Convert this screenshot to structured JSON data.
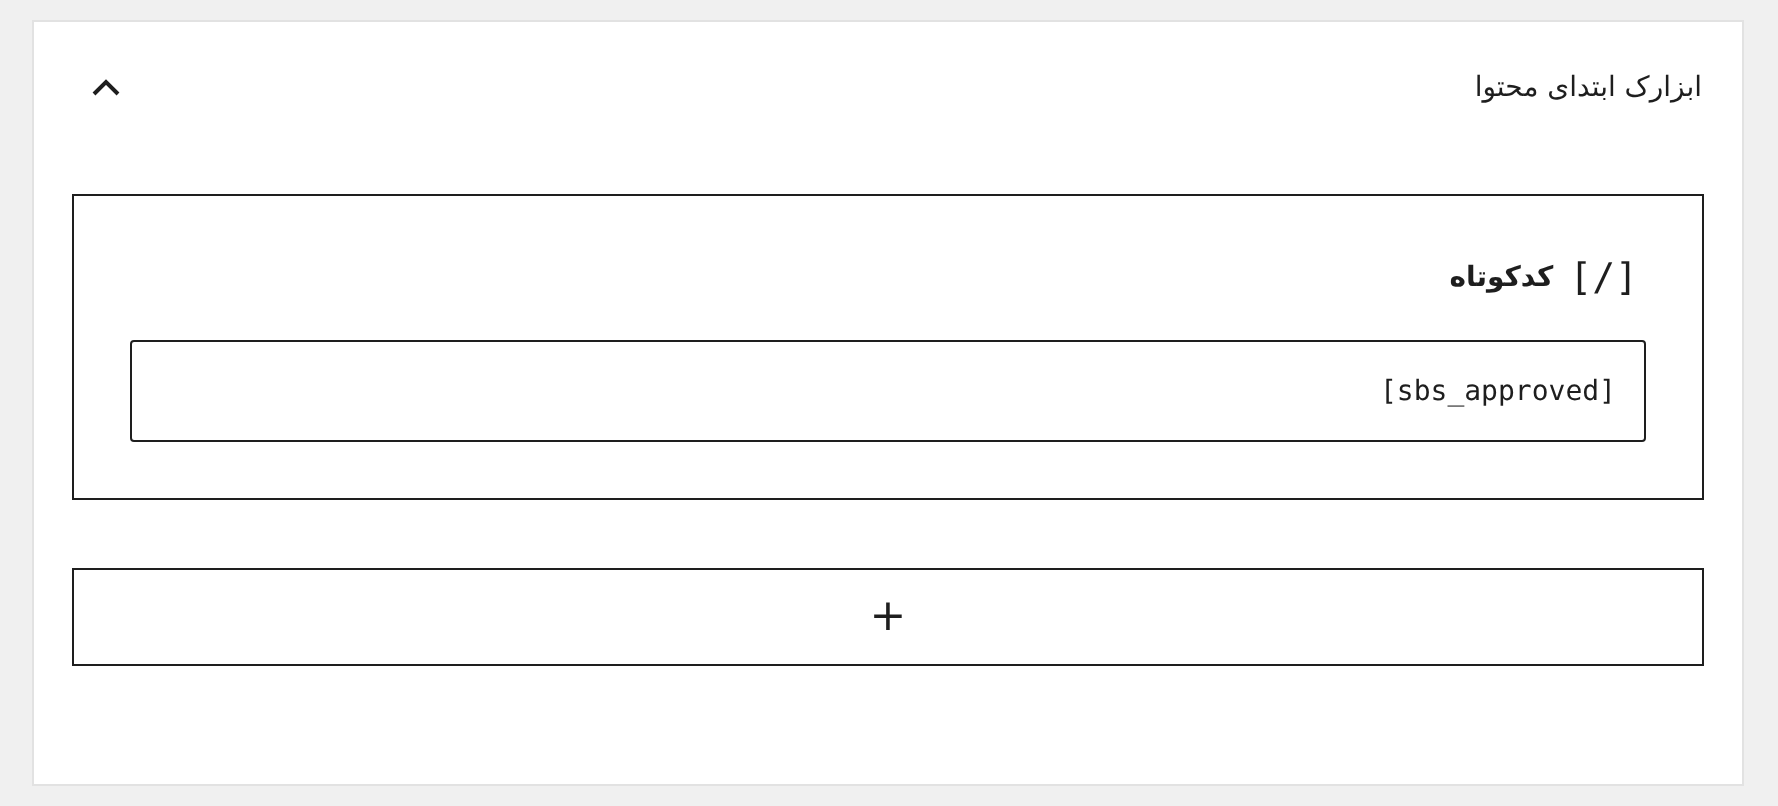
{
  "panel": {
    "title": "ابزارک ابتدای محتوا",
    "expanded": true
  },
  "block": {
    "icon": "[/]",
    "label": "کدکوتاه",
    "value": "[sbs_approved]"
  },
  "add_button": {
    "label": "+"
  }
}
